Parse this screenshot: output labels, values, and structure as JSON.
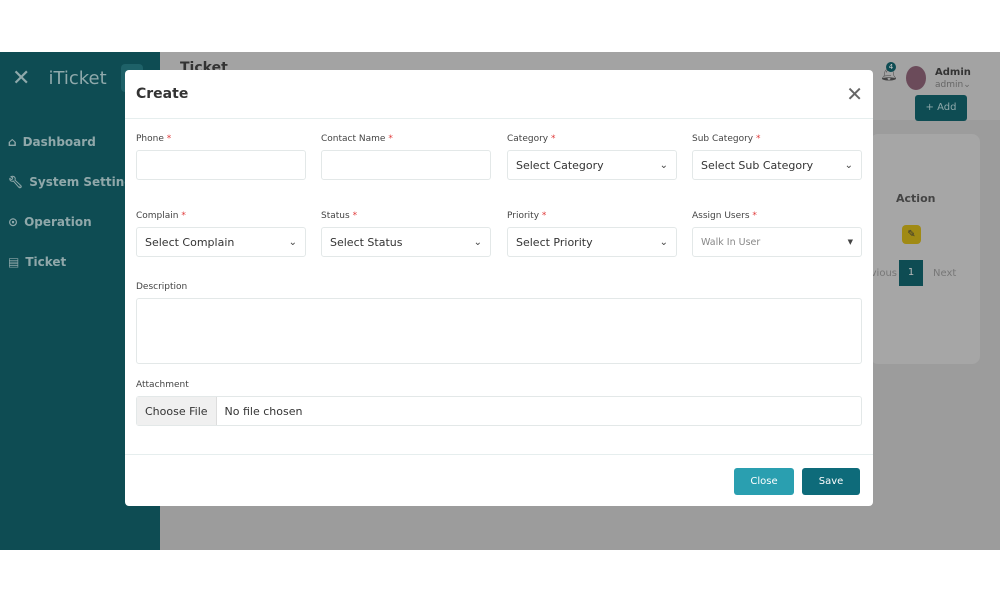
{
  "sidebar": {
    "app_name": "iTicket",
    "items": [
      {
        "label": "Dashboard",
        "icon": "home-icon"
      },
      {
        "label": "System Setting",
        "icon": "wrench-icon"
      },
      {
        "label": "Operation",
        "icon": "circle-dot-icon"
      },
      {
        "label": "Ticket",
        "icon": "ticket-icon"
      }
    ]
  },
  "header": {
    "title": "Ticket",
    "notifications": "4",
    "user_name": "Admin",
    "user_role": "admin"
  },
  "page": {
    "add_label": "+ Add",
    "action_header": "Action",
    "prev_label": "Previous",
    "page": "1",
    "next_label": "Next"
  },
  "modal": {
    "title": "Create",
    "fields": [
      {
        "label": "Phone",
        "value": ""
      },
      {
        "label": "Contact Name",
        "value": ""
      },
      {
        "label": "Category",
        "value": "Select Category"
      },
      {
        "label": "Sub Category",
        "value": "Select Sub Category"
      },
      {
        "label": "Complain",
        "value": "Select Complain"
      },
      {
        "label": "Status",
        "value": "Select Status"
      },
      {
        "label": "Priority",
        "value": "Select Priority"
      },
      {
        "label": "Assign Users",
        "value": "Walk In User"
      }
    ],
    "description_label": "Description",
    "attachment_label": "Attachment",
    "choose_file": "Choose File",
    "no_file": "No file chosen",
    "close_label": "Close",
    "save_label": "Save"
  },
  "colors": {
    "sidebar": "#0e4c53",
    "primary": "#0e6b7a",
    "close_btn": "#2a9fb0",
    "required": "#e03b3b"
  }
}
